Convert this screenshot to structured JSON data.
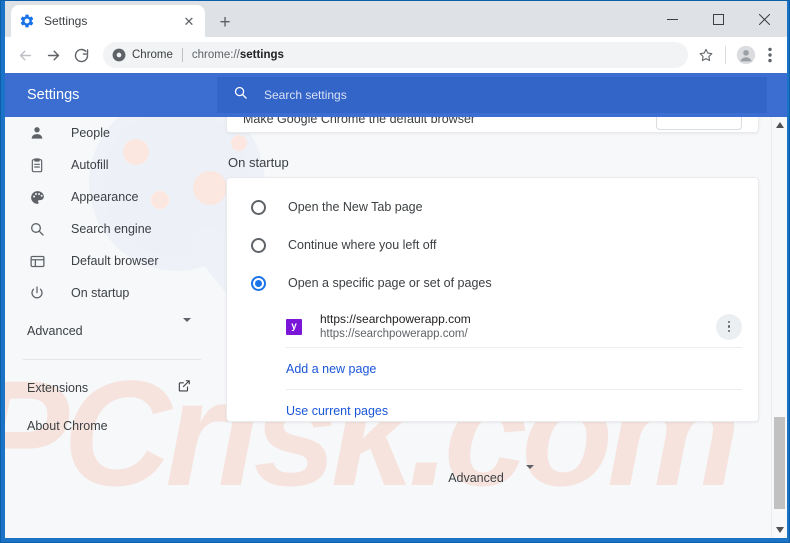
{
  "window": {
    "controls": [
      {
        "name": "minimize",
        "glyph": "minimize-icon"
      },
      {
        "name": "maximize",
        "glyph": "maximize-icon"
      },
      {
        "name": "close",
        "glyph": "close-icon"
      }
    ],
    "frame_color": "#1a73c7"
  },
  "tabstrip": {
    "tab_title": "Settings",
    "tab_favicon": "gear-icon",
    "close_glyph": "✕",
    "newtab_glyph": "+"
  },
  "toolbar": {
    "back": "back-arrow-icon",
    "forward": "forward-arrow-icon",
    "reload": "reload-icon",
    "omnibox": {
      "chip_icon": "chrome-logo-icon",
      "chip_label": "Chrome",
      "url_prefix": "chrome://",
      "url_bold": "settings"
    },
    "bookmark": "star-icon",
    "profile": "avatar-icon",
    "menu": "three-dot-menu-icon"
  },
  "settings_header": {
    "title": "Settings",
    "search_placeholder": "Search settings",
    "search_icon": "search-icon",
    "bg_color": "#3b6ed0",
    "search_bg_color": "#3364c8"
  },
  "sidebar": {
    "items": [
      {
        "label": "People",
        "icon": "person-icon"
      },
      {
        "label": "Autofill",
        "icon": "clipboard-icon"
      },
      {
        "label": "Appearance",
        "icon": "palette-icon"
      },
      {
        "label": "Search engine",
        "icon": "search-icon"
      },
      {
        "label": "Default browser",
        "icon": "browser-window-icon"
      },
      {
        "label": "On startup",
        "icon": "power-icon"
      }
    ],
    "advanced": {
      "label": "Advanced",
      "icon": "chevron-down-icon"
    },
    "footer_items": [
      {
        "label": "Extensions",
        "icon": "external-link-icon"
      },
      {
        "label": "About Chrome",
        "icon": ""
      }
    ]
  },
  "main": {
    "default_browser_card": {
      "label": "Make Google Chrome the default browser",
      "button_label": ""
    },
    "section_heading": "On startup",
    "startup_options": [
      {
        "label": "Open the New Tab page",
        "selected": false
      },
      {
        "label": "Continue where you left off",
        "selected": false
      },
      {
        "label": "Open a specific page or set of pages",
        "selected": true
      }
    ],
    "startup_pages": [
      {
        "title": "https://searchpowerapp.com",
        "url": "https://searchpowerapp.com/",
        "favicon_letter": "y",
        "favicon_color": "#7b16d9",
        "menu_icon": "three-dot-menu-icon"
      }
    ],
    "links": [
      {
        "label": "Add a new page"
      },
      {
        "label": "Use current pages"
      }
    ],
    "link_color": "#1a56d8",
    "advanced_footer": {
      "label": "Advanced",
      "icon": "chevron-down-icon"
    }
  },
  "scrollbar": {
    "up_arrow": "caret-up-icon",
    "down_arrow": "caret-down-icon"
  },
  "watermark": {
    "text": "PCrisk.com",
    "color": "#f6e3dd"
  }
}
